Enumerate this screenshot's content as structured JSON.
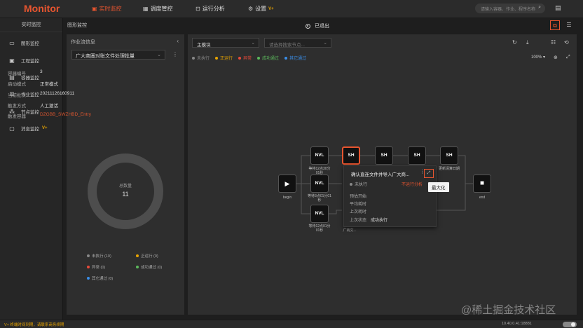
{
  "app": {
    "title": "Monitor"
  },
  "nav": {
    "items": [
      {
        "label": "实时监控",
        "icon": "monitor-icon",
        "active": true
      },
      {
        "label": "调度管控",
        "icon": "calendar-icon",
        "active": false
      },
      {
        "label": "运行分析",
        "icon": "chart-icon",
        "active": false
      },
      {
        "label": "设置",
        "icon": "gear-icon",
        "active": false,
        "badge": "V+"
      }
    ]
  },
  "search": {
    "placeholder": "请输入容器、作业、程序名称"
  },
  "sidebar": {
    "title": "实时监控",
    "items": [
      {
        "label": "图形监控",
        "icon": "graph-icon"
      },
      {
        "label": "工程监控",
        "icon": "project-icon"
      },
      {
        "label": "容器监控",
        "icon": "container-icon"
      },
      {
        "label": "作业监控",
        "icon": "job-icon"
      },
      {
        "label": "节点监控",
        "icon": "node-icon"
      },
      {
        "label": "消息监控",
        "icon": "message-icon",
        "badge": "V+"
      }
    ]
  },
  "breadcrumb": "图形监控",
  "status_top": "已退出",
  "left_panel": {
    "title": "作业流信息",
    "job_select": "广大商圈对账文件处理批量",
    "info": [
      {
        "key": "容器编号",
        "value": "3"
      },
      {
        "key": "启动模式",
        "value": "正常模式"
      },
      {
        "key": "当前批次",
        "value": "20211126160911"
      },
      {
        "key": "触发方式",
        "value": "人工激活"
      },
      {
        "key": "触发容器",
        "value": "DZGBB_SWZHBD_Entry"
      }
    ],
    "donut_label": "总数量",
    "donut_value": "11",
    "legend": [
      {
        "label": "未执行 (10)",
        "color": "#888888"
      },
      {
        "label": "正运行 (0)",
        "color": "#e8a400"
      },
      {
        "label": "异常 (0)",
        "color": "#e84a3a"
      },
      {
        "label": "成功通过 (0)",
        "color": "#5cb85c"
      },
      {
        "label": "其它通过 (0)",
        "color": "#3a8ee8"
      }
    ]
  },
  "main": {
    "module_select": "主模块",
    "node_search_placeholder": "请选择搜索节点...",
    "status_legend": [
      {
        "label": "未执行",
        "color": "#888888"
      },
      {
        "label": "正运行",
        "color": "#e8a400"
      },
      {
        "label": "异常",
        "color": "#e84a3a"
      },
      {
        "label": "成功通过",
        "color": "#5cb85c"
      },
      {
        "label": "其它通过",
        "color": "#3a8ee8"
      }
    ],
    "zoom": "100% ▾"
  },
  "graph": {
    "begin_label": "begin",
    "end_label": "end",
    "nodes": [
      {
        "text": "NVL",
        "label": "等待12点30分01秒"
      },
      {
        "text": "NVL",
        "label": "等待3点01分01秒"
      },
      {
        "text": "NVL",
        "label": "等待12点01分01秒"
      },
      {
        "text": "SH",
        "label": ""
      },
      {
        "text": "SH",
        "label": ""
      },
      {
        "text": "SH",
        "label": ""
      },
      {
        "text": "SH",
        "label": "更新清算日期"
      }
    ],
    "hidden_label_fragment": "广商文..."
  },
  "popup": {
    "title": "确认直连文件并导入广大商...",
    "status": "未执行",
    "link": "不运行分析",
    "rows": [
      {
        "key": "预估开始",
        "value": ""
      },
      {
        "key": "平均耗时",
        "value": ""
      },
      {
        "key": "上次耗时",
        "value": ""
      },
      {
        "key": "上次状态",
        "value": "成功执行"
      }
    ]
  },
  "tooltip": "最大化",
  "bottombar": {
    "left": "V+ 终端时间到期，请联系商务续期",
    "right": "10.40.0.41:18881"
  },
  "watermark": "@稀土掘金技术社区"
}
